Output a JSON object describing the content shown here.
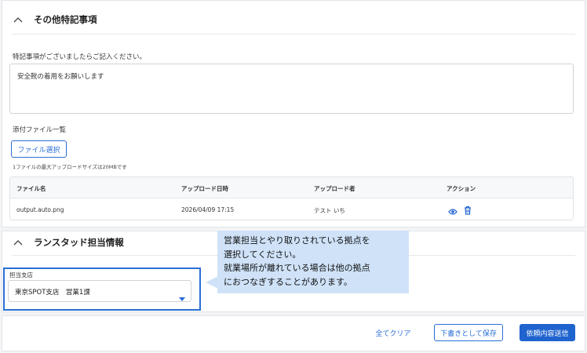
{
  "section1": {
    "title": "その他特記事項",
    "notes_label": "特記事項がございましたらご記入ください。",
    "notes_value": "安全靴の着用をお願いします",
    "attachments_label": "添付ファイル一覧",
    "file_select_button": "ファイル選択",
    "max_size_note": "1ファイルの最大アップロードサイズは20MBです",
    "table": {
      "headers": [
        "ファイル名",
        "アップロード日時",
        "アップロード者",
        "アクション"
      ],
      "rows": [
        {
          "file_name": "output.auto.png",
          "uploaded_at": "2026/04/09 17:15",
          "uploader": "テスト いち"
        }
      ]
    }
  },
  "section2": {
    "title": "ランスタッド担当情報",
    "branch_label": "担当支店",
    "branch_value": "東京SPOT支店　営業1課"
  },
  "tooltip": {
    "line1": "営業担当とやり取りされている拠点を",
    "line2": "選択してください。",
    "line3": "就業場所が離れている場合は他の拠点",
    "line4": "におつなぎすることがあります。"
  },
  "footer": {
    "clear_all": "全てクリア",
    "save_draft": "下書きとして保存",
    "submit": "依頼内容送信"
  },
  "colors": {
    "accent": "#2a6fd6",
    "primary_button": "#1f63cf",
    "tooltip_bg": "#cfe2f8"
  },
  "icons": [
    "chevron-up-icon",
    "eye-icon",
    "trash-icon",
    "dropdown-arrow-icon"
  ]
}
